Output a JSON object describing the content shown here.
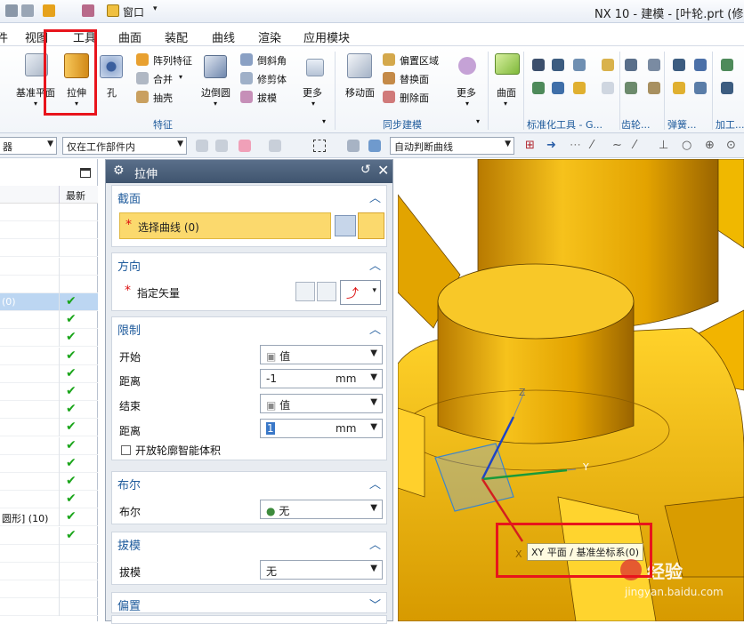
{
  "titlebar": {
    "title": "NX 10 - 建模 - [叶轮.prt (修",
    "window_menu": "窗口"
  },
  "menu": [
    "视图",
    "工具",
    "曲面",
    "装配",
    "曲线",
    "渲染",
    "应用模块"
  ],
  "menu_partial_left": "件",
  "ribbon": {
    "datum_label": "基准平面",
    "extrude_label": "拉伸",
    "hole_label": "孔",
    "pattern_label": "阵列特征",
    "unite_label": "合并",
    "shell_label": "抽壳",
    "edge_blend_label": "边倒圆",
    "chamfer_label": "倒斜角",
    "trim_body_label": "修剪体",
    "draft_label": "拔模",
    "more1_label": "更多",
    "feature_group": "特征",
    "move_face_label": "移动面",
    "offset_region_label": "偏置区域",
    "replace_face_label": "替换面",
    "delete_face_label": "删除面",
    "more2_label": "更多",
    "sync_group": "同步建模",
    "surface_label": "曲面",
    "std_tool_group": "标准化工具 - G...",
    "gear_group": "齿轮...",
    "spring_group": "弹簧...",
    "process_group": "加工..."
  },
  "cmdbar": {
    "filter_left": "器",
    "scope": "仅在工作部件内",
    "curve_rule": "自动判断曲线"
  },
  "nav": {
    "latest_header": "最新",
    "selected_row": "(0)",
    "circle_row": "圆形] (10)"
  },
  "dialog": {
    "title": "拉伸",
    "section": "截面",
    "select_curve": "选择曲线 (0)",
    "direction": "方向",
    "specify_vector": "指定矢量",
    "limits": "限制",
    "start": "开始",
    "start_mode": "值",
    "distance": "距离",
    "start_distance": "-1",
    "unit": "mm",
    "end": "结束",
    "end_mode": "值",
    "end_distance": "1",
    "open_profile": "开放轮廓智能体积",
    "boolean": "布尔",
    "boolean_value": "无",
    "draft": "拔模",
    "draft_value": "无",
    "offset": "偏置"
  },
  "viewport": {
    "tooltip": "XY 平面 / 基准坐标系(0)",
    "axis_x": "X",
    "axis_y": "Y",
    "axis_z": "Z",
    "watermark": "经验",
    "watermark_url": "jingyan.baidu.com"
  },
  "colors": {
    "accent": "#1f5b9c",
    "part": "#f2b400",
    "highlight": "#e8141c",
    "section_fill": "#fbd96d"
  }
}
